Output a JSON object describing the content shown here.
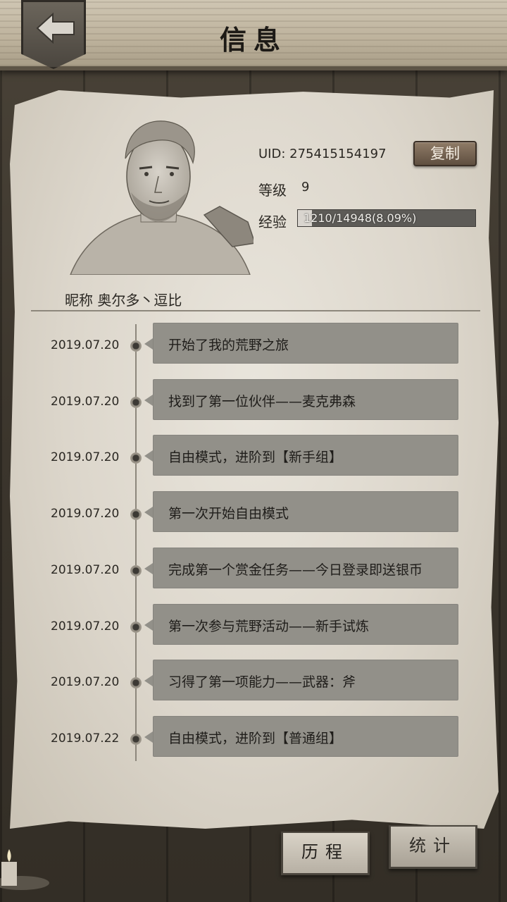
{
  "header": {
    "title": "信息",
    "back_icon": "back-arrow-icon"
  },
  "profile": {
    "uid_text": "UID: 275415154197",
    "copy_label": "复制",
    "level_label": "等级",
    "level_value": "9",
    "exp_label": "经验",
    "exp_text": "1210/14948(8.09%)",
    "exp_fraction": 0.0809,
    "nickname_text": "昵称  奥尔多丶逗比"
  },
  "timeline": [
    {
      "date": "2019.07.20",
      "text": "开始了我的荒野之旅"
    },
    {
      "date": "2019.07.20",
      "text": "找到了第一位伙伴——麦克弗森"
    },
    {
      "date": "2019.07.20",
      "text": "自由模式，进阶到【新手组】"
    },
    {
      "date": "2019.07.20",
      "text": "第一次开始自由模式"
    },
    {
      "date": "2019.07.20",
      "text": "完成第一个赏金任务——今日登录即送银币"
    },
    {
      "date": "2019.07.20",
      "text": "第一次参与荒野活动——新手试炼"
    },
    {
      "date": "2019.07.20",
      "text": "习得了第一项能力——武器：斧"
    },
    {
      "date": "2019.07.22",
      "text": "自由模式，进阶到【普通组】"
    }
  ],
  "tabs": {
    "history_label": "历程",
    "stats_label": "统计"
  }
}
